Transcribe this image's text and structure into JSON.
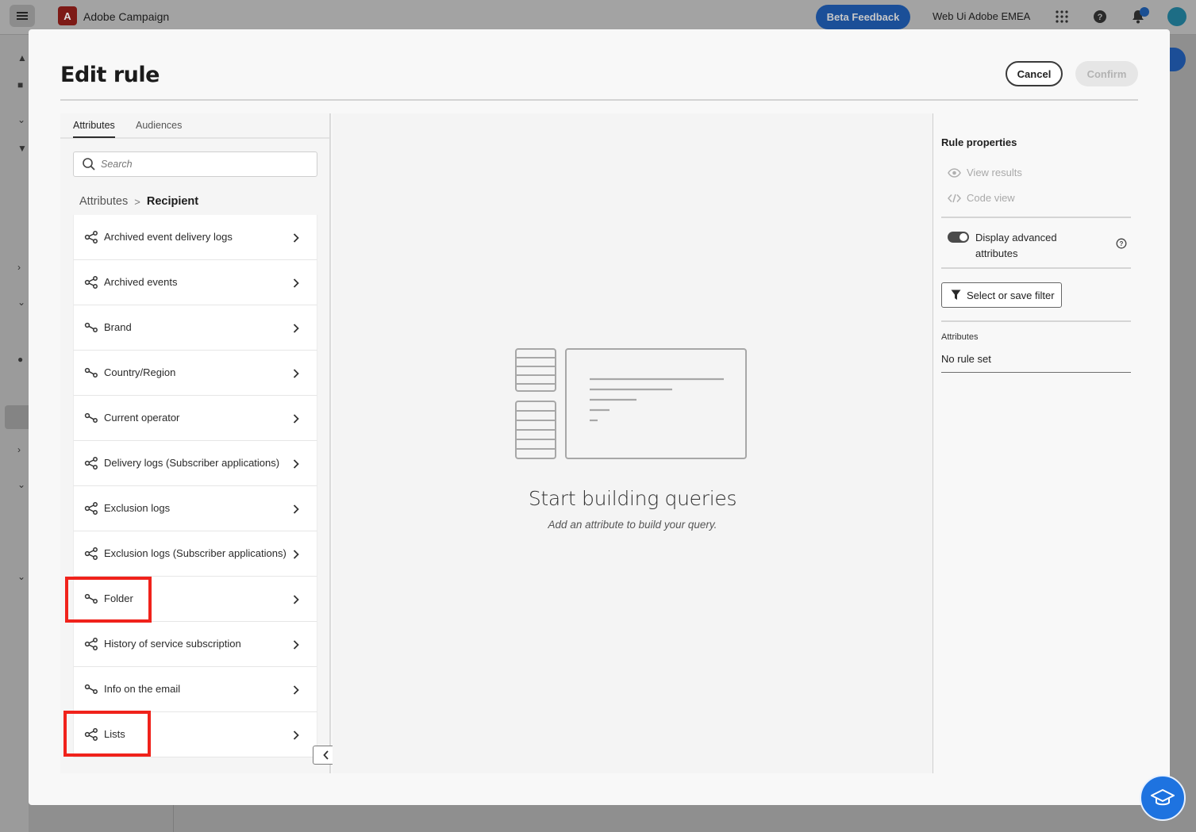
{
  "app": {
    "title": "Adobe Campaign",
    "beta_button": "Beta Feedback",
    "org_name": "Web Ui Adobe EMEA"
  },
  "modal": {
    "title": "Edit rule",
    "cancel_label": "Cancel",
    "confirm_label": "Confirm"
  },
  "left_panel": {
    "tabs": [
      {
        "label": "Attributes",
        "active": true
      },
      {
        "label": "Audiences",
        "active": false
      }
    ],
    "search_placeholder": "Search",
    "breadcrumb": {
      "root": "Attributes",
      "separator": ">",
      "current": "Recipient"
    },
    "items": [
      {
        "label": "Archived event delivery logs",
        "icon": "multi-link-icon"
      },
      {
        "label": "Archived events",
        "icon": "multi-link-icon"
      },
      {
        "label": "Brand",
        "icon": "single-link-icon"
      },
      {
        "label": "Country/Region",
        "icon": "single-link-icon"
      },
      {
        "label": "Current operator",
        "icon": "single-link-icon"
      },
      {
        "label": "Delivery logs (Subscriber applications)",
        "icon": "multi-link-icon"
      },
      {
        "label": "Exclusion logs",
        "icon": "multi-link-icon"
      },
      {
        "label": "Exclusion logs (Subscriber applications)",
        "icon": "multi-link-icon"
      },
      {
        "label": "Folder",
        "icon": "single-link-icon",
        "highlighted": true
      },
      {
        "label": "History of service subscription",
        "icon": "multi-link-icon"
      },
      {
        "label": "Info on the email",
        "icon": "single-link-icon"
      },
      {
        "label": "Lists",
        "icon": "multi-link-icon",
        "highlighted": true
      }
    ]
  },
  "canvas": {
    "empty_title": "Start building queries",
    "empty_subtitle": "Add an attribute to build your query."
  },
  "right_panel": {
    "title": "Rule properties",
    "view_results": "View results",
    "code_view": "Code view",
    "advanced_toggle_label": "Display advanced attributes",
    "advanced_toggle_on": true,
    "filter_button": "Select or save filter",
    "attributes_label": "Attributes",
    "attributes_value": "No rule set"
  },
  "colors": {
    "highlight": "#f0221b",
    "accent_blue": "#1e73e0"
  }
}
